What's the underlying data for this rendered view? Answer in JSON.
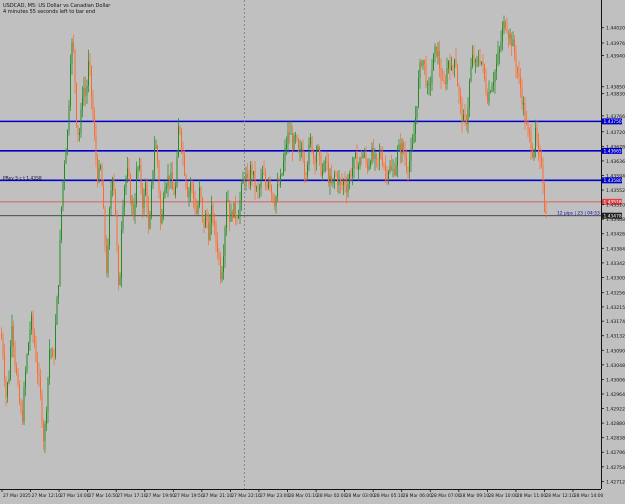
{
  "header": {
    "symbol_line": "USDCAD, M5:  US Dollar vs Canadian Dollar",
    "countdown_line": "4 minutes 55 seconds left to bar end"
  },
  "colors": {
    "background": "#c0c0c0",
    "bull": "#228b22",
    "bear": "#ff6a2a",
    "level_line": "#0000cd",
    "bid_line": "#e04040",
    "ask_line": "#202020",
    "crosshair": "#7a7a7a"
  },
  "chart_data": {
    "type": "candlestick",
    "symbol": "USDCAD",
    "timeframe": "M5",
    "ylim": [
      1.4269,
      1.441
    ],
    "y_ticks": [
      "1.44020",
      "1.43976",
      "1.43940",
      "1.43850",
      "1.43830",
      "1.43766",
      "1.43720",
      "1.43678",
      "1.43636",
      "1.43594",
      "1.43552",
      "1.43510",
      "1.43468",
      "1.43426",
      "1.43384",
      "1.43342",
      "1.43300",
      "1.43256",
      "1.43215",
      "1.43174",
      "1.43132",
      "1.43090",
      "1.43048",
      "1.43006",
      "1.42964",
      "1.42922",
      "1.42880",
      "1.42838",
      "1.42796",
      "1.42754",
      "1.42712"
    ],
    "y_tick_values": [
      1.4402,
      1.43976,
      1.4394,
      1.4385,
      1.4383,
      1.43766,
      1.4372,
      1.43678,
      1.43636,
      1.43594,
      1.43552,
      1.4351,
      1.43468,
      1.43426,
      1.43384,
      1.43342,
      1.433,
      1.43256,
      1.43215,
      1.43174,
      1.43132,
      1.4309,
      1.43048,
      1.43006,
      1.42964,
      1.42922,
      1.4288,
      1.42838,
      1.42796,
      1.42754,
      1.42712
    ],
    "x_ticks": [
      "27 Mar 2025",
      "27 Mar 12:10",
      "27 Mar 14:00",
      "27 Mar 16:50",
      "27 Mar 17:10",
      "27 Mar 19:00",
      "27 Mar 19:50",
      "27 Mar 21:10",
      "27 Mar 22:10",
      "27 Mar 23:00",
      "28 Mar 01:10",
      "28 Mar 02:00",
      "28 Mar 03:00",
      "28 Mar 05:10",
      "28 Mar 06:00",
      "28 Mar 07:00",
      "28 Mar 09:10",
      "28 Mar 10:00",
      "28 Mar 11:00",
      "28 Mar 12:10",
      "28 Mar 14:00"
    ],
    "horizontal_lines": [
      {
        "price": 1.4375,
        "label": "1.43750",
        "kind": "level"
      },
      {
        "price": 1.43665,
        "label": "1.43665",
        "kind": "level"
      },
      {
        "price": 1.4358,
        "label": "1.43580",
        "kind": "level",
        "annotation": "PRev 5 c t 1.4358"
      },
      {
        "price": 1.43518,
        "label": "1.43518",
        "kind": "bid"
      },
      {
        "price": 1.43478,
        "label": "1.43478",
        "kind": "ask",
        "annotation": "12 pips | 23 | 04:53"
      }
    ],
    "price_path": [
      [
        0,
        1.4316
      ],
      [
        3,
        1.4309
      ],
      [
        6,
        1.4296
      ],
      [
        9,
        1.4302
      ],
      [
        12,
        1.4318
      ],
      [
        15,
        1.4306
      ],
      [
        18,
        1.4297
      ],
      [
        22,
        1.4288
      ],
      [
        25,
        1.4301
      ],
      [
        28,
        1.431
      ],
      [
        31,
        1.4318
      ],
      [
        34,
        1.4312
      ],
      [
        38,
        1.4302
      ],
      [
        41,
        1.4294
      ],
      [
        44,
        1.4282
      ],
      [
        47,
        1.4296
      ],
      [
        50,
        1.4312
      ],
      [
        53,
        1.4304
      ],
      [
        56,
        1.4318
      ],
      [
        59,
        1.4332
      ],
      [
        62,
        1.4354
      ],
      [
        65,
        1.4366
      ],
      [
        68,
        1.4373
      ],
      [
        71,
        1.4398
      ],
      [
        74,
        1.4394
      ],
      [
        77,
        1.4372
      ],
      [
        80,
        1.4372
      ],
      [
        83,
        1.4386
      ],
      [
        86,
        1.4382
      ],
      [
        89,
        1.4393
      ],
      [
        92,
        1.438
      ],
      [
        95,
        1.4368
      ],
      [
        98,
        1.4358
      ],
      [
        101,
        1.4362
      ],
      [
        104,
        1.4345
      ],
      [
        107,
        1.433
      ],
      [
        110,
        1.4352
      ],
      [
        113,
        1.4362
      ],
      [
        116,
        1.4346
      ],
      [
        119,
        1.4322
      ],
      [
        122,
        1.435
      ],
      [
        125,
        1.4358
      ],
      [
        128,
        1.436
      ],
      [
        131,
        1.4352
      ],
      [
        134,
        1.4348
      ],
      [
        137,
        1.4362
      ],
      [
        140,
        1.436
      ],
      [
        143,
        1.435
      ],
      [
        146,
        1.4358
      ],
      [
        149,
        1.434
      ],
      [
        152,
        1.4358
      ],
      [
        155,
        1.437
      ],
      [
        158,
        1.4362
      ],
      [
        161,
        1.4342
      ],
      [
        164,
        1.4358
      ],
      [
        167,
        1.4358
      ],
      [
        170,
        1.436
      ],
      [
        173,
        1.4354
      ],
      [
        176,
        1.4356
      ],
      [
        179,
        1.4376
      ],
      [
        182,
        1.4368
      ],
      [
        185,
        1.436
      ],
      [
        188,
        1.4354
      ],
      [
        191,
        1.4358
      ],
      [
        194,
        1.4352
      ],
      [
        197,
        1.4348
      ],
      [
        200,
        1.4356
      ],
      [
        203,
        1.4344
      ],
      [
        206,
        1.4348
      ],
      [
        209,
        1.4342
      ],
      [
        212,
        1.435
      ],
      [
        215,
        1.4342
      ],
      [
        218,
        1.4338
      ],
      [
        221,
        1.433
      ],
      [
        224,
        1.434
      ],
      [
        227,
        1.4356
      ],
      [
        230,
        1.4346
      ],
      [
        233,
        1.435
      ],
      [
        236,
        1.4348
      ],
      [
        239,
        1.435
      ],
      [
        242,
        1.4356
      ],
      [
        245,
        1.436
      ],
      [
        248,
        1.4356
      ],
      [
        251,
        1.4362
      ],
      [
        254,
        1.4358
      ],
      [
        257,
        1.4354
      ],
      [
        260,
        1.4356
      ],
      [
        263,
        1.436
      ],
      [
        266,
        1.4356
      ],
      [
        269,
        1.436
      ],
      [
        272,
        1.4354
      ],
      [
        275,
        1.4352
      ],
      [
        278,
        1.4356
      ],
      [
        281,
        1.4358
      ],
      [
        284,
        1.4364
      ],
      [
        287,
        1.437
      ],
      [
        290,
        1.4372
      ],
      [
        293,
        1.4368
      ],
      [
        296,
        1.437
      ],
      [
        299,
        1.4364
      ],
      [
        302,
        1.4368
      ],
      [
        305,
        1.436
      ],
      [
        308,
        1.4365
      ],
      [
        311,
        1.437
      ],
      [
        314,
        1.4364
      ],
      [
        317,
        1.4368
      ],
      [
        320,
        1.4362
      ],
      [
        323,
        1.436
      ],
      [
        326,
        1.4364
      ],
      [
        329,
        1.4358
      ],
      [
        332,
        1.4356
      ],
      [
        335,
        1.436
      ],
      [
        338,
        1.4358
      ],
      [
        341,
        1.4356
      ],
      [
        344,
        1.4358
      ],
      [
        347,
        1.4356
      ],
      [
        350,
        1.436
      ],
      [
        353,
        1.4362
      ],
      [
        356,
        1.4364
      ],
      [
        359,
        1.4362
      ],
      [
        362,
        1.4366
      ],
      [
        365,
        1.4364
      ],
      [
        368,
        1.4362
      ],
      [
        371,
        1.4366
      ],
      [
        374,
        1.4364
      ],
      [
        377,
        1.4362
      ],
      [
        380,
        1.4366
      ],
      [
        383,
        1.4364
      ],
      [
        386,
        1.436
      ],
      [
        389,
        1.4362
      ],
      [
        392,
        1.436
      ],
      [
        395,
        1.4362
      ],
      [
        398,
        1.4366
      ],
      [
        401,
        1.4368
      ],
      [
        404,
        1.4366
      ],
      [
        407,
        1.4362
      ],
      [
        410,
        1.4364
      ],
      [
        413,
        1.4368
      ],
      [
        416,
        1.4378
      ],
      [
        419,
        1.4388
      ],
      [
        422,
        1.4394
      ],
      [
        425,
        1.439
      ],
      [
        428,
        1.4382
      ],
      [
        431,
        1.4388
      ],
      [
        434,
        1.4394
      ],
      [
        437,
        1.4396
      ],
      [
        440,
        1.439
      ],
      [
        443,
        1.4384
      ],
      [
        446,
        1.4388
      ],
      [
        449,
        1.4394
      ],
      [
        452,
        1.4388
      ],
      [
        455,
        1.4396
      ],
      [
        458,
        1.4384
      ],
      [
        461,
        1.4378
      ],
      [
        464,
        1.4374
      ],
      [
        467,
        1.4376
      ],
      [
        470,
        1.4388
      ],
      [
        473,
        1.4394
      ],
      [
        476,
        1.439
      ],
      [
        479,
        1.4394
      ],
      [
        482,
        1.4392
      ],
      [
        485,
        1.4386
      ],
      [
        488,
        1.4382
      ],
      [
        491,
        1.4386
      ],
      [
        494,
        1.4388
      ],
      [
        497,
        1.4392
      ],
      [
        500,
        1.4396
      ],
      [
        503,
        1.4402
      ],
      [
        506,
        1.4404
      ],
      [
        509,
        1.44
      ],
      [
        512,
        1.4398
      ],
      [
        515,
        1.4394
      ],
      [
        518,
        1.4388
      ],
      [
        521,
        1.4384
      ],
      [
        524,
        1.4378
      ],
      [
        527,
        1.4372
      ],
      [
        530,
        1.437
      ],
      [
        533,
        1.4366
      ],
      [
        536,
        1.4372
      ],
      [
        539,
        1.4362
      ],
      [
        542,
        1.4364
      ],
      [
        545,
        1.4348
      ]
    ]
  }
}
